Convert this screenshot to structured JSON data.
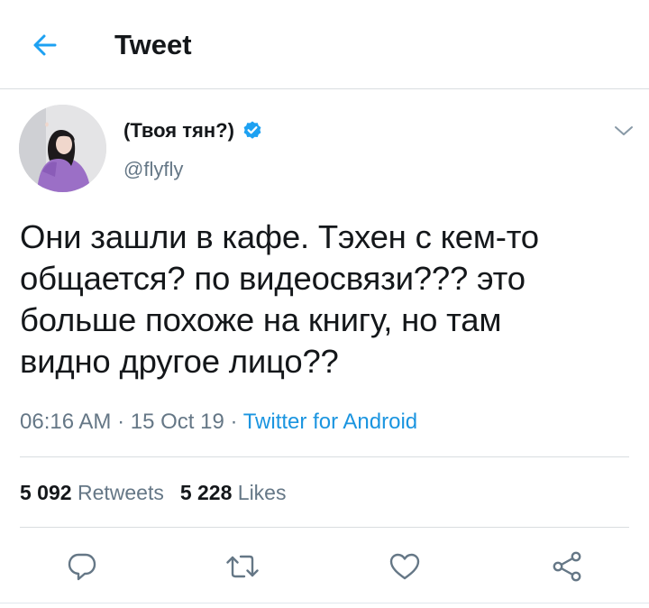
{
  "header": {
    "title": "Tweet"
  },
  "tweet": {
    "author_name": "(Твоя тян?)",
    "handle": "@flyfly",
    "verified": true,
    "text": "Они зашли в кафе. Тэхен с кем-то\nобщается? по видеосвязи??? это\nбольше похоже на книгу, но там\nвидно другое лицо??",
    "time": "06:16 AM",
    "date": "15 Oct 19",
    "separator": "·",
    "source": "Twitter for Android"
  },
  "stats": {
    "retweets_count": "5 092",
    "retweets_label": "Retweets",
    "likes_count": "5 228",
    "likes_label": "Likes"
  },
  "icons": {
    "back": "arrow-left-icon",
    "verified": "verified-badge-icon",
    "caret": "chevron-down-icon",
    "reply": "reply-icon",
    "retweet": "retweet-icon",
    "like": "heart-icon",
    "share": "share-icon"
  },
  "colors": {
    "accent": "#1da1f2",
    "link": "#1b95e0",
    "text": "#14171a",
    "secondary": "#657786",
    "divider": "#d9dde0"
  }
}
